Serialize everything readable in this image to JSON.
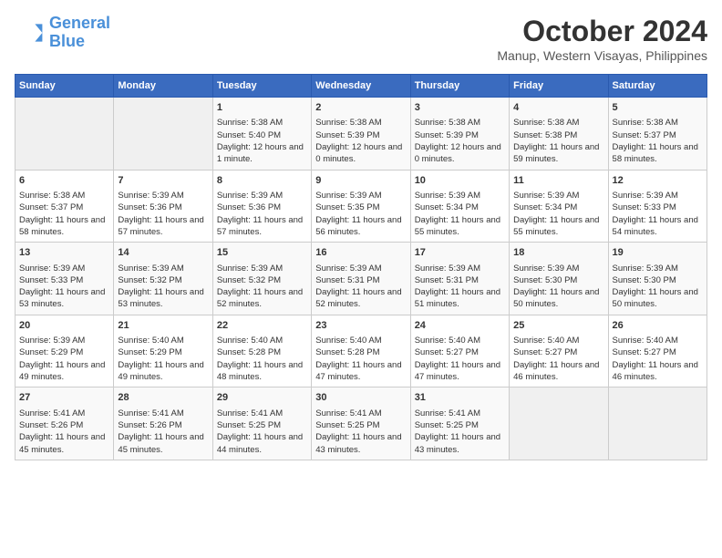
{
  "header": {
    "logo_line1": "General",
    "logo_line2": "Blue",
    "month": "October 2024",
    "location": "Manup, Western Visayas, Philippines"
  },
  "weekdays": [
    "Sunday",
    "Monday",
    "Tuesday",
    "Wednesday",
    "Thursday",
    "Friday",
    "Saturday"
  ],
  "weeks": [
    [
      {
        "day": "",
        "empty": true
      },
      {
        "day": "",
        "empty": true
      },
      {
        "day": "1",
        "sunrise": "5:38 AM",
        "sunset": "5:40 PM",
        "daylight": "12 hours and 1 minute."
      },
      {
        "day": "2",
        "sunrise": "5:38 AM",
        "sunset": "5:39 PM",
        "daylight": "12 hours and 0 minutes."
      },
      {
        "day": "3",
        "sunrise": "5:38 AM",
        "sunset": "5:39 PM",
        "daylight": "12 hours and 0 minutes."
      },
      {
        "day": "4",
        "sunrise": "5:38 AM",
        "sunset": "5:38 PM",
        "daylight": "11 hours and 59 minutes."
      },
      {
        "day": "5",
        "sunrise": "5:38 AM",
        "sunset": "5:37 PM",
        "daylight": "11 hours and 58 minutes."
      }
    ],
    [
      {
        "day": "6",
        "sunrise": "5:38 AM",
        "sunset": "5:37 PM",
        "daylight": "11 hours and 58 minutes."
      },
      {
        "day": "7",
        "sunrise": "5:39 AM",
        "sunset": "5:36 PM",
        "daylight": "11 hours and 57 minutes."
      },
      {
        "day": "8",
        "sunrise": "5:39 AM",
        "sunset": "5:36 PM",
        "daylight": "11 hours and 57 minutes."
      },
      {
        "day": "9",
        "sunrise": "5:39 AM",
        "sunset": "5:35 PM",
        "daylight": "11 hours and 56 minutes."
      },
      {
        "day": "10",
        "sunrise": "5:39 AM",
        "sunset": "5:34 PM",
        "daylight": "11 hours and 55 minutes."
      },
      {
        "day": "11",
        "sunrise": "5:39 AM",
        "sunset": "5:34 PM",
        "daylight": "11 hours and 55 minutes."
      },
      {
        "day": "12",
        "sunrise": "5:39 AM",
        "sunset": "5:33 PM",
        "daylight": "11 hours and 54 minutes."
      }
    ],
    [
      {
        "day": "13",
        "sunrise": "5:39 AM",
        "sunset": "5:33 PM",
        "daylight": "11 hours and 53 minutes."
      },
      {
        "day": "14",
        "sunrise": "5:39 AM",
        "sunset": "5:32 PM",
        "daylight": "11 hours and 53 minutes."
      },
      {
        "day": "15",
        "sunrise": "5:39 AM",
        "sunset": "5:32 PM",
        "daylight": "11 hours and 52 minutes."
      },
      {
        "day": "16",
        "sunrise": "5:39 AM",
        "sunset": "5:31 PM",
        "daylight": "11 hours and 52 minutes."
      },
      {
        "day": "17",
        "sunrise": "5:39 AM",
        "sunset": "5:31 PM",
        "daylight": "11 hours and 51 minutes."
      },
      {
        "day": "18",
        "sunrise": "5:39 AM",
        "sunset": "5:30 PM",
        "daylight": "11 hours and 50 minutes."
      },
      {
        "day": "19",
        "sunrise": "5:39 AM",
        "sunset": "5:30 PM",
        "daylight": "11 hours and 50 minutes."
      }
    ],
    [
      {
        "day": "20",
        "sunrise": "5:39 AM",
        "sunset": "5:29 PM",
        "daylight": "11 hours and 49 minutes."
      },
      {
        "day": "21",
        "sunrise": "5:40 AM",
        "sunset": "5:29 PM",
        "daylight": "11 hours and 49 minutes."
      },
      {
        "day": "22",
        "sunrise": "5:40 AM",
        "sunset": "5:28 PM",
        "daylight": "11 hours and 48 minutes."
      },
      {
        "day": "23",
        "sunrise": "5:40 AM",
        "sunset": "5:28 PM",
        "daylight": "11 hours and 47 minutes."
      },
      {
        "day": "24",
        "sunrise": "5:40 AM",
        "sunset": "5:27 PM",
        "daylight": "11 hours and 47 minutes."
      },
      {
        "day": "25",
        "sunrise": "5:40 AM",
        "sunset": "5:27 PM",
        "daylight": "11 hours and 46 minutes."
      },
      {
        "day": "26",
        "sunrise": "5:40 AM",
        "sunset": "5:27 PM",
        "daylight": "11 hours and 46 minutes."
      }
    ],
    [
      {
        "day": "27",
        "sunrise": "5:41 AM",
        "sunset": "5:26 PM",
        "daylight": "11 hours and 45 minutes."
      },
      {
        "day": "28",
        "sunrise": "5:41 AM",
        "sunset": "5:26 PM",
        "daylight": "11 hours and 45 minutes."
      },
      {
        "day": "29",
        "sunrise": "5:41 AM",
        "sunset": "5:25 PM",
        "daylight": "11 hours and 44 minutes."
      },
      {
        "day": "30",
        "sunrise": "5:41 AM",
        "sunset": "5:25 PM",
        "daylight": "11 hours and 43 minutes."
      },
      {
        "day": "31",
        "sunrise": "5:41 AM",
        "sunset": "5:25 PM",
        "daylight": "11 hours and 43 minutes."
      },
      {
        "day": "",
        "empty": true
      },
      {
        "day": "",
        "empty": true
      }
    ]
  ]
}
